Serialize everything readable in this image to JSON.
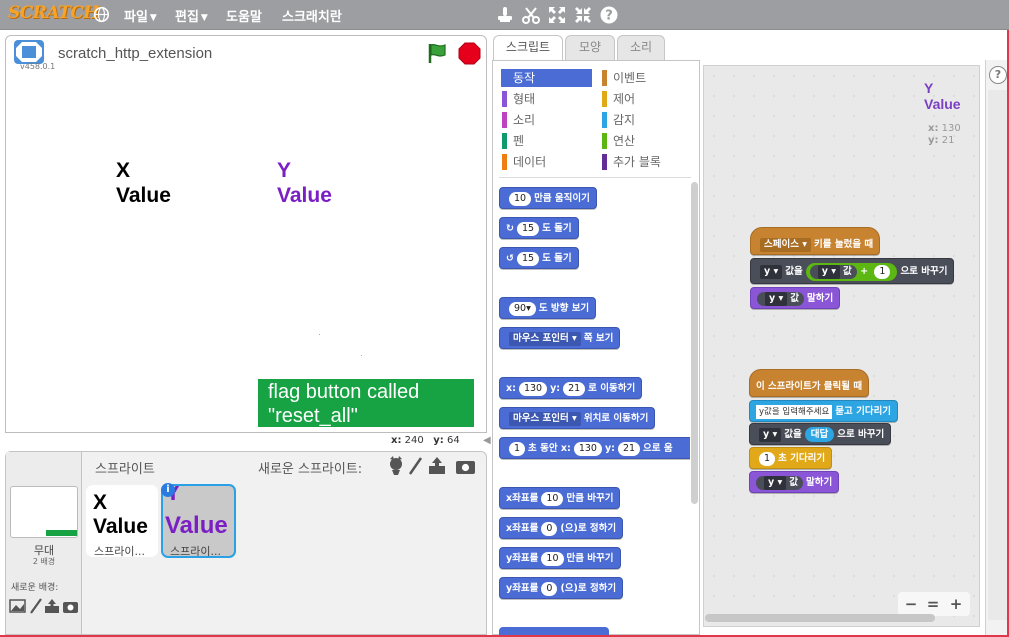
{
  "menubar": {
    "logo": "SCRATCH",
    "items": [
      {
        "label": "파일"
      },
      {
        "label": "편집"
      },
      {
        "label": "도움말"
      },
      {
        "label": "스크래치란"
      }
    ]
  },
  "stage": {
    "title": "scratch_http_extension",
    "version": "v458.0.1",
    "vars": [
      {
        "name": "X",
        "value": "Value",
        "color": "#000000"
      },
      {
        "name": "Y",
        "value": "Value",
        "color": "#7b1fc4"
      }
    ],
    "note": "flag button called \"reset_all\"",
    "coords": {
      "x_label": "x:",
      "x": "240",
      "y_label": "y:",
      "y": "64"
    }
  },
  "sprites": {
    "header": "스프라이트",
    "new_sprite_label": "새로운 스프라이트:",
    "stage_label": "무대",
    "stage_count": "2 배경",
    "new_backdrop_label": "새로운 배경:",
    "list": [
      {
        "name": "X",
        "value": "Value",
        "label": "스프라이...",
        "color": "#000000"
      },
      {
        "name": "Y",
        "value": "Value",
        "label": "스프라이...",
        "color": "#7b1fc4"
      }
    ],
    "info_glyph": "i"
  },
  "tabs": [
    {
      "label": "스크립트"
    },
    {
      "label": "모양"
    },
    {
      "label": "소리"
    }
  ],
  "categories": [
    {
      "label": "동작",
      "color": "#4a6cd4"
    },
    {
      "label": "이벤트",
      "color": "#c88330"
    },
    {
      "label": "형태",
      "color": "#8a55d7"
    },
    {
      "label": "제어",
      "color": "#e1a91a"
    },
    {
      "label": "소리",
      "color": "#bb42c3"
    },
    {
      "label": "감지",
      "color": "#2ca5e2"
    },
    {
      "label": "펜",
      "color": "#0e9a6c"
    },
    {
      "label": "연산",
      "color": "#5cb712"
    },
    {
      "label": "데이터",
      "color": "#ee7d16"
    },
    {
      "label": "추가 블록",
      "color": "#632d99"
    }
  ],
  "palette": {
    "move": {
      "value": "10",
      "text": "만큼 움직이기"
    },
    "turn_right": {
      "value": "15",
      "text": "도 돌기"
    },
    "turn_left": {
      "value": "15",
      "text": "도 돌기"
    },
    "point_dir": {
      "value": "90▾",
      "text": "도 방향 보기"
    },
    "point_towards": {
      "drop": "마우스 포인터",
      "text": "쪽 보기"
    },
    "goto_xy": {
      "x_label": "x:",
      "x": "130",
      "y_label": "y:",
      "y": "21",
      "text": "로 이동하기"
    },
    "goto": {
      "drop": "마우스 포인터",
      "text": "위치로 이동하기"
    },
    "glide": {
      "value": "1",
      "text1": "초 동안 x:",
      "x": "130",
      "y_label": "y:",
      "y": "21",
      "text2": "으로 움"
    },
    "change_x": {
      "text1": "x좌표를",
      "value": "10",
      "text2": "만큼 바꾸기"
    },
    "set_x": {
      "text1": "x좌표를",
      "value": "0",
      "text2": "(으)로 정하기"
    },
    "change_y": {
      "text1": "y좌표를",
      "value": "10",
      "text2": "만큼 바꾸기"
    },
    "set_y": {
      "text1": "y좌표를",
      "value": "0",
      "text2": "(으)로 정하기"
    }
  },
  "scripts": {
    "var_name": "Y",
    "var_value": "Value",
    "x_label": "x:",
    "x": "130",
    "y_label": "y:",
    "y": "21",
    "script1": {
      "hat_drop": "스페이스",
      "hat_text": "키를 눌렀을 때",
      "set_drop": "y",
      "set_text1": "값을",
      "reporter_drop": "y",
      "reporter_text": "값",
      "plus": "+",
      "plus_value": "1",
      "set_text2": "으로 바꾸기",
      "say_drop": "y",
      "say_text1": "값",
      "say_text2": "말하기"
    },
    "script2": {
      "hat_text": "이 스프라이트가 클릭될 때",
      "ask_input": "y값을 입력해주세요",
      "ask_text": "묻고 기다리기",
      "set_drop": "y",
      "set_text1": "값을",
      "answer": "대답",
      "set_text2": "으로 바꾸기",
      "wait_value": "1",
      "wait_text": "초 기다리기",
      "say_drop": "y",
      "say_text1": "값",
      "say_text2": "말하기"
    }
  },
  "zoom": {
    "out": "−",
    "reset": "=",
    "in": "+"
  },
  "help": "?"
}
